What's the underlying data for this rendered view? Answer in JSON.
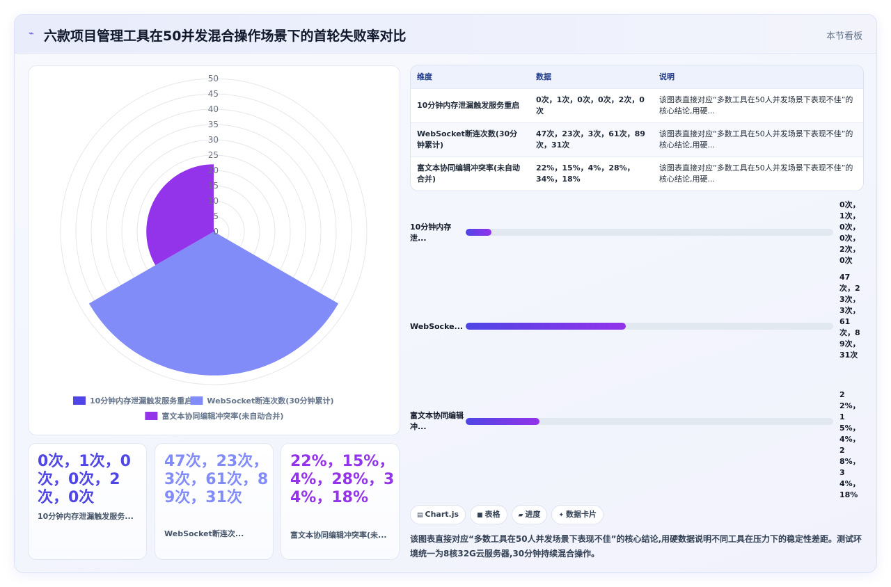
{
  "header": {
    "icon": "chart-sparkle-icon",
    "title": "六款项目管理工具在50并发混合操作场景下的首轮失败率对比",
    "link": "本节看板"
  },
  "chart_data": {
    "type": "polarArea",
    "title": "",
    "categories": [
      "10分钟内存泄漏触发服务重启",
      "WebSocket断连次数(30分钟累计)",
      "富文本协同编辑冲突率(未自动合并)"
    ],
    "values": [
      0.5,
      47,
      22
    ],
    "colors": [
      "#4f46e5",
      "#818cf8",
      "#9333ea"
    ],
    "radial_ticks": [
      0,
      5,
      10,
      15,
      20,
      25,
      30,
      35,
      40,
      45,
      50
    ],
    "rmax": 50,
    "grid": true,
    "legend_position": "bottom"
  },
  "stats": [
    {
      "value": "0次，1次，0次，0次，2次，0次",
      "label": "10分钟内存泄漏触发服务...",
      "color": "#4f46e5"
    },
    {
      "value": "47次，23次，3次，61次，89次，31次",
      "label": "WebSocket断连次...",
      "color": "#818cf8"
    },
    {
      "value": "22%，15%，4%，28%，34%，18%",
      "label": "富文本协同编辑冲突率(未...",
      "color": "#9333ea"
    }
  ],
  "table": {
    "headers": [
      "维度",
      "数据",
      "说明"
    ],
    "rows": [
      {
        "dimension": "10分钟内存泄漏触发服务重启",
        "data": "0次，1次，0次，0次，2次，0次",
        "note": "该图表直接对应“多数工具在50人并发场景下表现不佳”的核心结论,用硬..."
      },
      {
        "dimension": "WebSocket断连次数(30分钟累计)",
        "data": "47次，23次，3次，61次，89次，31次",
        "note": "该图表直接对应“多数工具在50人并发场景下表现不佳”的核心结论,用硬..."
      },
      {
        "dimension": "富文本协同编辑冲突率(未自动合并)",
        "data": "22%，15%，4%，28%，34%，18%",
        "note": "该图表直接对应“多数工具在50人并发场景下表现不佳”的核心结论,用硬..."
      }
    ]
  },
  "bars": [
    {
      "label": "10分钟内存泄...",
      "value": "0次，1次，0次，0次，2次，0次",
      "fraction": 0.07
    },
    {
      "label": "WebSocke...",
      "value": "47次，23次，3次，61次，89次，31次",
      "fraction": 0.435
    },
    {
      "label": "富文本协同编辑冲...",
      "value": "22%，15%，4%，28%，34%，18%",
      "fraction": 0.2
    }
  ],
  "chips": [
    {
      "icon": "chart-icon",
      "glyph": "▤",
      "label": "Chart.js"
    },
    {
      "icon": "table-icon",
      "glyph": "■",
      "label": "表格"
    },
    {
      "icon": "progress-icon",
      "glyph": "▰",
      "label": "进度"
    },
    {
      "icon": "card-icon",
      "glyph": "✦",
      "label": "数据卡片"
    }
  ],
  "note": "该图表直接对应“多数工具在50人并发场景下表现不佳”的核心结论,用硬数据说明不同工具在压力下的稳定性差距。测试环境统一为8核32G云服务器,30分钟持续混合操作。"
}
